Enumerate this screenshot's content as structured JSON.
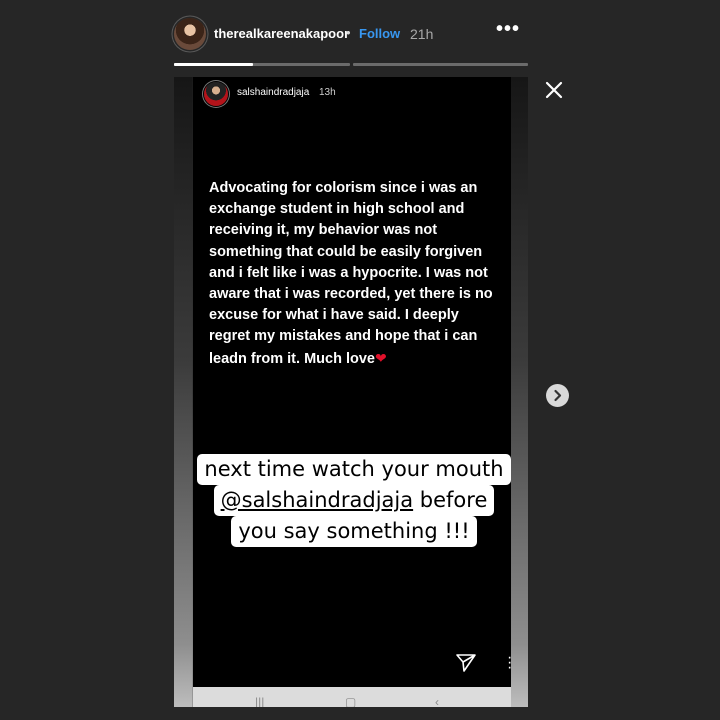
{
  "header": {
    "username": "therealkareenakapoor",
    "separator": "•",
    "follow_label": "Follow",
    "time": "21h",
    "more_icon": "more-horizontal-icon",
    "avatar_icon": "profile-avatar"
  },
  "progress": {
    "segments": 2,
    "current_segment": 1,
    "current_fraction": 0.45
  },
  "story": {
    "inner_username": "salshaindradjaja",
    "inner_time": "13h",
    "apology_text": "Advocating for colorism since i was an exchange student in high school and receiving it, my behavior was not something that could be easily forgiven and i felt like i was a hypocrite. I was not aware that i was recorded, yet there is no excuse for what i have said. I deeply regret my mistakes and hope that i can leadn from it. Much love",
    "heart_glyph": "❤",
    "sticker": {
      "line1": "next time watch your mouth",
      "mention": "@salshaindradjaja",
      "line2_rest": " before",
      "line3": "you say something !!!"
    },
    "send_icon": "send-icon",
    "inner_more_icon": "vertical-dots-icon"
  },
  "controls": {
    "close_icon": "close-icon",
    "next_icon": "chevron-right-icon"
  },
  "colors": {
    "background": "#262626",
    "follow": "#3897f0",
    "heart": "#e0102a"
  }
}
